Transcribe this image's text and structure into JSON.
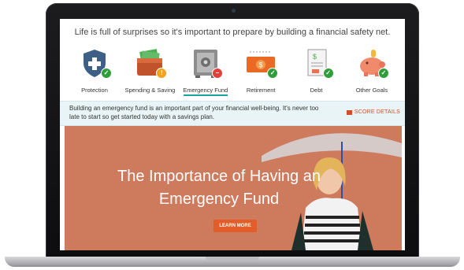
{
  "headline": "Life is full of surprises so it's important to prepare by building a financial safety net.",
  "categories": [
    {
      "label": "Protection",
      "icon": "shield-icon",
      "status": "complete"
    },
    {
      "label": "Spending & Saving",
      "icon": "wallet-icon",
      "status": "warning"
    },
    {
      "label": "Emergency Fund",
      "icon": "safe-icon",
      "status": "alert",
      "active": true
    },
    {
      "label": "Retirement",
      "icon": "money-bill-icon",
      "status": "complete"
    },
    {
      "label": "Debt",
      "icon": "bill-document-icon",
      "status": "complete"
    },
    {
      "label": "Other Goals",
      "icon": "piggy-bank-icon",
      "status": "complete"
    }
  ],
  "info": {
    "text": "Building an emergency fund is an important part of your financial well-being. It's never too late to start so get started today with a savings plan.",
    "score_link": "SCORE DETAILS"
  },
  "hero": {
    "title": "The Importance of Having an Emergency Fund",
    "button": "LEARN MORE"
  },
  "colors": {
    "accent": "#1aa3a3",
    "status_ok": "#2e9e3a",
    "status_warn": "#f3a21b",
    "status_alert": "#e0413a",
    "hero_bg": "#ce7a5c",
    "cta": "#e35d2a"
  }
}
